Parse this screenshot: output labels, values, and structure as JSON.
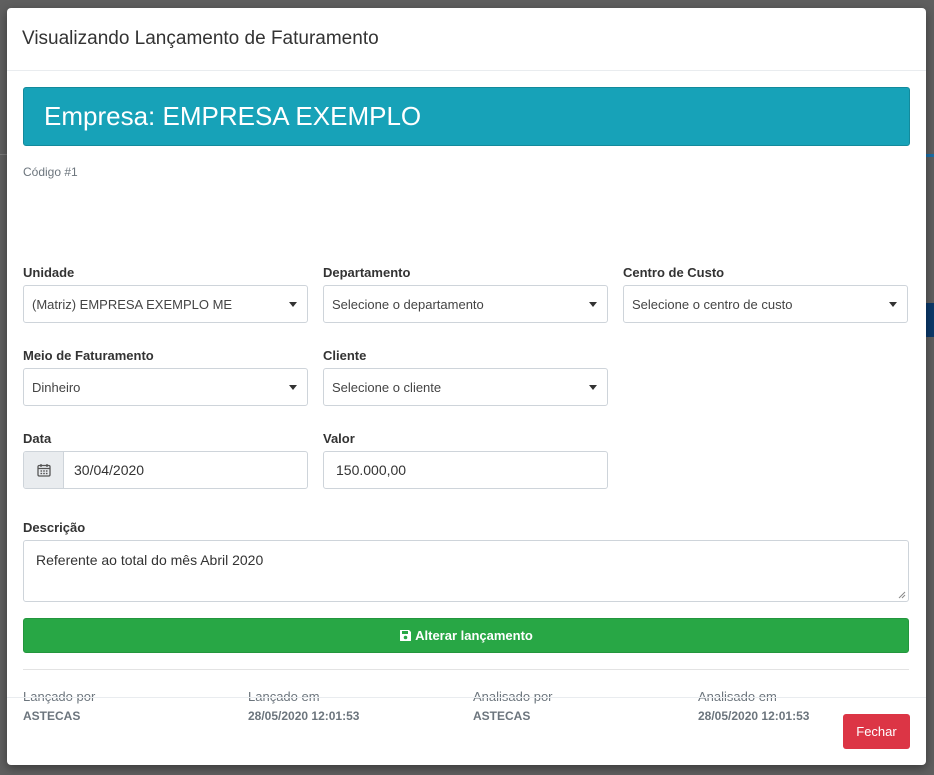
{
  "modal": {
    "title": "Visualizando Lançamento de Faturamento",
    "banner": "Empresa: EMPRESA EXEMPLO",
    "codigo": "Código #1"
  },
  "fields": {
    "unidade": {
      "label": "Unidade",
      "value": "(Matriz) EMPRESA EXEMPLO ME"
    },
    "departamento": {
      "label": "Departamento",
      "value": "Selecione o departamento"
    },
    "centro_custo": {
      "label": "Centro de Custo",
      "value": "Selecione o centro de custo"
    },
    "meio_faturamento": {
      "label": "Meio de Faturamento",
      "value": "Dinheiro"
    },
    "cliente": {
      "label": "Cliente",
      "value": "Selecione o cliente"
    },
    "data": {
      "label": "Data",
      "value": "30/04/2020"
    },
    "valor": {
      "label": "Valor",
      "value": "150.000,00"
    },
    "descricao": {
      "label": "Descrição",
      "value": "Referente ao total do mês Abril 2020"
    }
  },
  "actions": {
    "alterar_label": "Alterar lançamento",
    "fechar_label": "Fechar"
  },
  "meta": [
    {
      "label": "Lançado por",
      "value": "ASTECAS"
    },
    {
      "label": "Lançado em",
      "value": "28/05/2020 12:01:53"
    },
    {
      "label": "Analisado por",
      "value": "ASTECAS"
    },
    {
      "label": "Analisado em",
      "value": "28/05/2020 12:01:53"
    }
  ],
  "colors": {
    "banner": "#17a2b8",
    "success": "#28a745",
    "danger": "#dc3545"
  },
  "icons": {
    "date": "calendar-icon",
    "save": "floppy-disk-icon",
    "dropdown": "caret-down-icon"
  }
}
